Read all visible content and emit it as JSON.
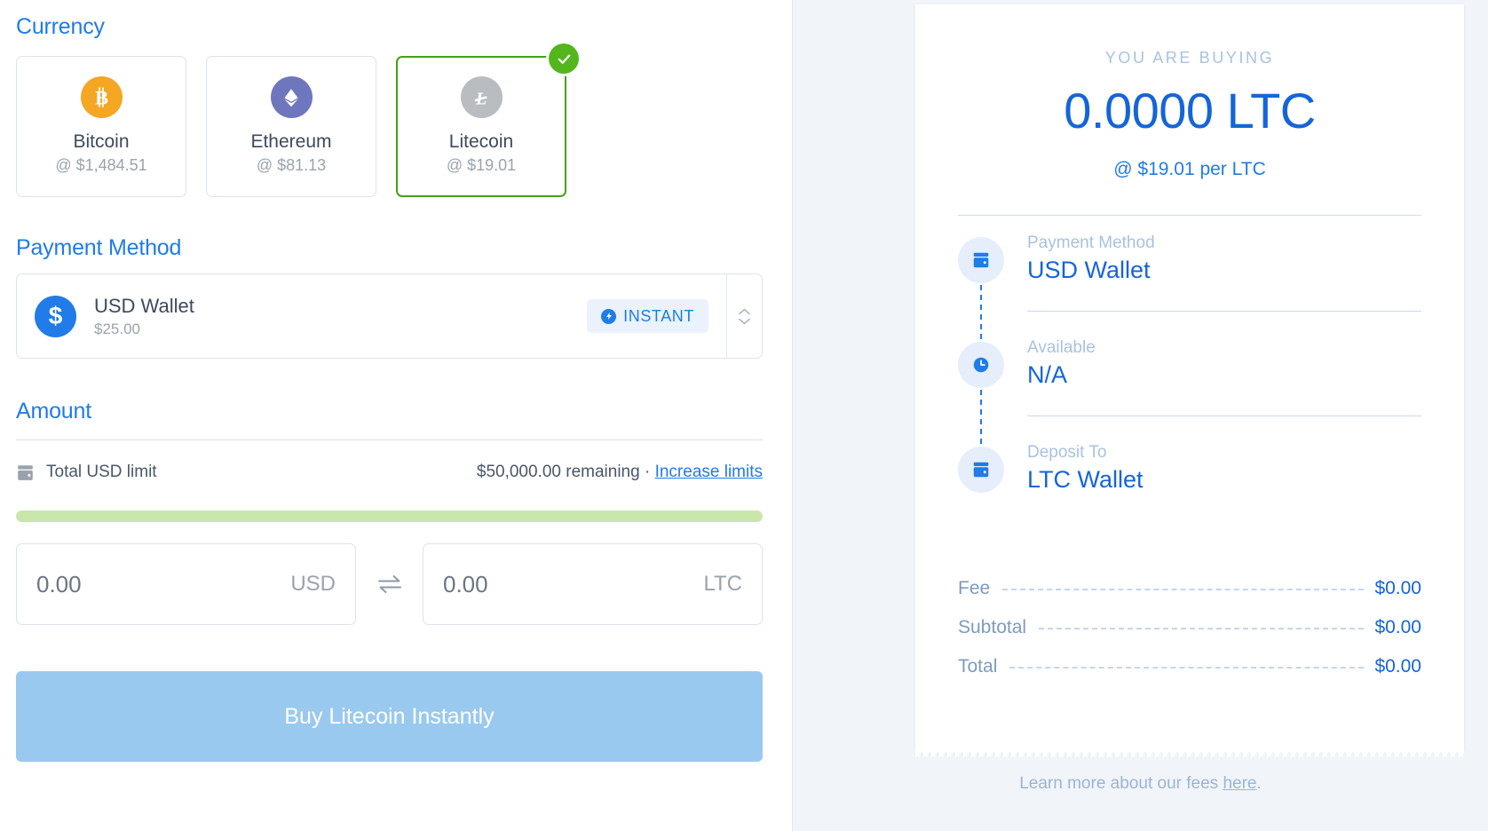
{
  "left": {
    "currency": {
      "title": "Currency",
      "options": [
        {
          "name": "Bitcoin",
          "price": "@ $1,484.51",
          "symbol": "Ƀ",
          "icon": "bitcoin-icon",
          "selected": false
        },
        {
          "name": "Ethereum",
          "price": "@ $81.13",
          "symbol": "",
          "icon": "ethereum-icon",
          "selected": false
        },
        {
          "name": "Litecoin",
          "price": "@ $19.01",
          "symbol": "Ł",
          "icon": "litecoin-icon",
          "selected": true
        }
      ]
    },
    "payment": {
      "title": "Payment Method",
      "wallet_symbol": "$",
      "wallet_name": "USD Wallet",
      "wallet_balance": "$25.00",
      "badge_label": "INSTANT",
      "badge_icon": "lightning-bolt-icon"
    },
    "amount": {
      "title": "Amount",
      "limit_label": "Total USD limit",
      "limit_remaining": "$50,000.00 remaining",
      "limit_separator": "·",
      "limit_link": "Increase limits",
      "limit_bar_color": "#c9e7ab",
      "fiat_value": "0.00",
      "fiat_currency": "USD",
      "crypto_value": "0.00",
      "crypto_currency": "LTC",
      "swap_icon": "swap-arrows-icon"
    },
    "buy_button": {
      "label": "Buy Litecoin Instantly",
      "color": "#9ac9ef"
    }
  },
  "right": {
    "buying_label": "YOU ARE BUYING",
    "buying_amount": "0.0000 LTC",
    "buying_rate": "@ $19.01 per LTC",
    "timeline": [
      {
        "label": "Payment Method",
        "value": "USD Wallet",
        "icon": "wallet-icon"
      },
      {
        "label": "Available",
        "value": "N/A",
        "icon": "clock-icon"
      },
      {
        "label": "Deposit To",
        "value": "LTC Wallet",
        "icon": "wallet-icon"
      }
    ],
    "totals": [
      {
        "label": "Fee",
        "value": "$0.00"
      },
      {
        "label": "Subtotal",
        "value": "$0.00"
      },
      {
        "label": "Total",
        "value": "$0.00"
      }
    ],
    "fees_note_prefix": "Learn more about our fees ",
    "fees_note_link": "here",
    "fees_note_suffix": "."
  },
  "colors": {
    "accent_blue": "#1f7ce8",
    "deep_blue": "#1565d8",
    "selected_green": "#52b61c",
    "bitcoin_orange": "#f5a623",
    "ethereum_purple": "#6e76bd",
    "litecoin_gray": "#b9bcc0"
  }
}
